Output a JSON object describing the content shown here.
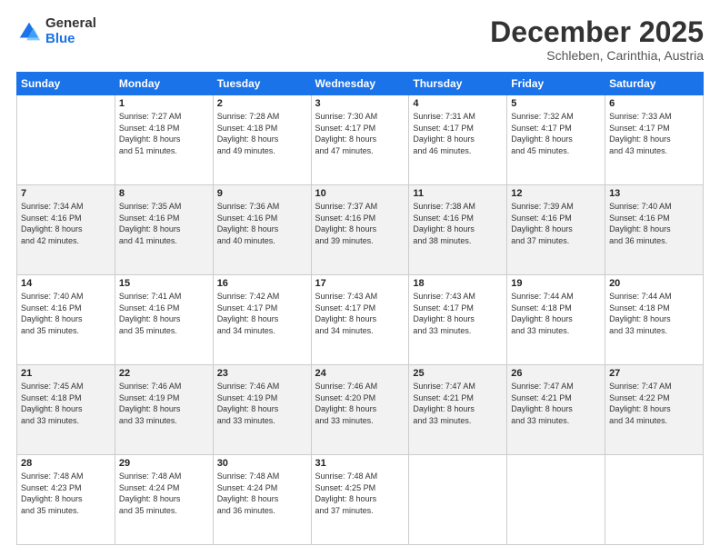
{
  "logo": {
    "general": "General",
    "blue": "Blue"
  },
  "header": {
    "month": "December 2025",
    "location": "Schleben, Carinthia, Austria"
  },
  "days_of_week": [
    "Sunday",
    "Monday",
    "Tuesday",
    "Wednesday",
    "Thursday",
    "Friday",
    "Saturday"
  ],
  "weeks": [
    [
      {
        "day": "",
        "info": ""
      },
      {
        "day": "1",
        "info": "Sunrise: 7:27 AM\nSunset: 4:18 PM\nDaylight: 8 hours\nand 51 minutes."
      },
      {
        "day": "2",
        "info": "Sunrise: 7:28 AM\nSunset: 4:18 PM\nDaylight: 8 hours\nand 49 minutes."
      },
      {
        "day": "3",
        "info": "Sunrise: 7:30 AM\nSunset: 4:17 PM\nDaylight: 8 hours\nand 47 minutes."
      },
      {
        "day": "4",
        "info": "Sunrise: 7:31 AM\nSunset: 4:17 PM\nDaylight: 8 hours\nand 46 minutes."
      },
      {
        "day": "5",
        "info": "Sunrise: 7:32 AM\nSunset: 4:17 PM\nDaylight: 8 hours\nand 45 minutes."
      },
      {
        "day": "6",
        "info": "Sunrise: 7:33 AM\nSunset: 4:17 PM\nDaylight: 8 hours\nand 43 minutes."
      }
    ],
    [
      {
        "day": "7",
        "info": "Sunrise: 7:34 AM\nSunset: 4:16 PM\nDaylight: 8 hours\nand 42 minutes."
      },
      {
        "day": "8",
        "info": "Sunrise: 7:35 AM\nSunset: 4:16 PM\nDaylight: 8 hours\nand 41 minutes."
      },
      {
        "day": "9",
        "info": "Sunrise: 7:36 AM\nSunset: 4:16 PM\nDaylight: 8 hours\nand 40 minutes."
      },
      {
        "day": "10",
        "info": "Sunrise: 7:37 AM\nSunset: 4:16 PM\nDaylight: 8 hours\nand 39 minutes."
      },
      {
        "day": "11",
        "info": "Sunrise: 7:38 AM\nSunset: 4:16 PM\nDaylight: 8 hours\nand 38 minutes."
      },
      {
        "day": "12",
        "info": "Sunrise: 7:39 AM\nSunset: 4:16 PM\nDaylight: 8 hours\nand 37 minutes."
      },
      {
        "day": "13",
        "info": "Sunrise: 7:40 AM\nSunset: 4:16 PM\nDaylight: 8 hours\nand 36 minutes."
      }
    ],
    [
      {
        "day": "14",
        "info": "Sunrise: 7:40 AM\nSunset: 4:16 PM\nDaylight: 8 hours\nand 35 minutes."
      },
      {
        "day": "15",
        "info": "Sunrise: 7:41 AM\nSunset: 4:16 PM\nDaylight: 8 hours\nand 35 minutes."
      },
      {
        "day": "16",
        "info": "Sunrise: 7:42 AM\nSunset: 4:17 PM\nDaylight: 8 hours\nand 34 minutes."
      },
      {
        "day": "17",
        "info": "Sunrise: 7:43 AM\nSunset: 4:17 PM\nDaylight: 8 hours\nand 34 minutes."
      },
      {
        "day": "18",
        "info": "Sunrise: 7:43 AM\nSunset: 4:17 PM\nDaylight: 8 hours\nand 33 minutes."
      },
      {
        "day": "19",
        "info": "Sunrise: 7:44 AM\nSunset: 4:18 PM\nDaylight: 8 hours\nand 33 minutes."
      },
      {
        "day": "20",
        "info": "Sunrise: 7:44 AM\nSunset: 4:18 PM\nDaylight: 8 hours\nand 33 minutes."
      }
    ],
    [
      {
        "day": "21",
        "info": "Sunrise: 7:45 AM\nSunset: 4:18 PM\nDaylight: 8 hours\nand 33 minutes."
      },
      {
        "day": "22",
        "info": "Sunrise: 7:46 AM\nSunset: 4:19 PM\nDaylight: 8 hours\nand 33 minutes."
      },
      {
        "day": "23",
        "info": "Sunrise: 7:46 AM\nSunset: 4:19 PM\nDaylight: 8 hours\nand 33 minutes."
      },
      {
        "day": "24",
        "info": "Sunrise: 7:46 AM\nSunset: 4:20 PM\nDaylight: 8 hours\nand 33 minutes."
      },
      {
        "day": "25",
        "info": "Sunrise: 7:47 AM\nSunset: 4:21 PM\nDaylight: 8 hours\nand 33 minutes."
      },
      {
        "day": "26",
        "info": "Sunrise: 7:47 AM\nSunset: 4:21 PM\nDaylight: 8 hours\nand 33 minutes."
      },
      {
        "day": "27",
        "info": "Sunrise: 7:47 AM\nSunset: 4:22 PM\nDaylight: 8 hours\nand 34 minutes."
      }
    ],
    [
      {
        "day": "28",
        "info": "Sunrise: 7:48 AM\nSunset: 4:23 PM\nDaylight: 8 hours\nand 35 minutes."
      },
      {
        "day": "29",
        "info": "Sunrise: 7:48 AM\nSunset: 4:24 PM\nDaylight: 8 hours\nand 35 minutes."
      },
      {
        "day": "30",
        "info": "Sunrise: 7:48 AM\nSunset: 4:24 PM\nDaylight: 8 hours\nand 36 minutes."
      },
      {
        "day": "31",
        "info": "Sunrise: 7:48 AM\nSunset: 4:25 PM\nDaylight: 8 hours\nand 37 minutes."
      },
      {
        "day": "",
        "info": ""
      },
      {
        "day": "",
        "info": ""
      },
      {
        "day": "",
        "info": ""
      }
    ]
  ]
}
